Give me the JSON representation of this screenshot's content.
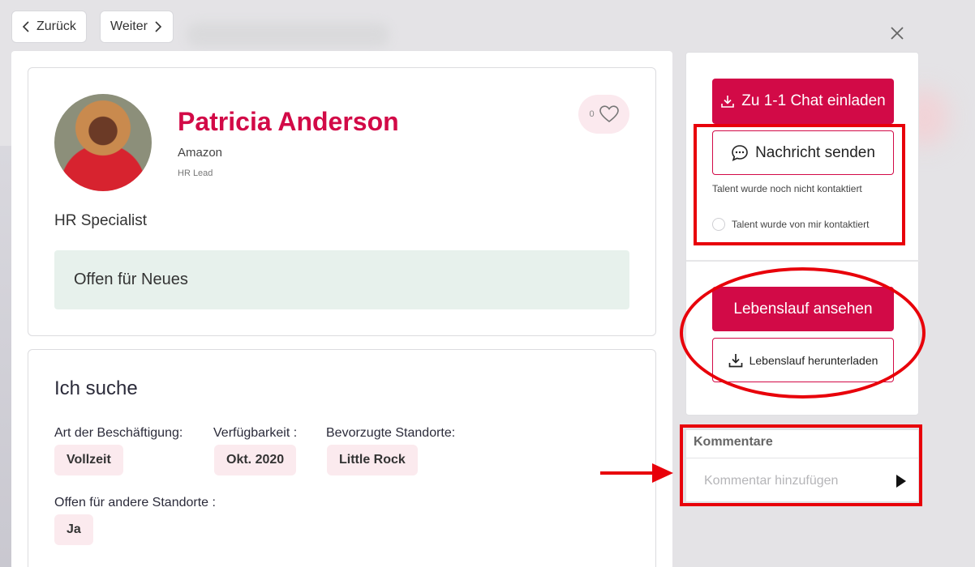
{
  "nav": {
    "back_label": "Zurück",
    "next_label": "Weiter"
  },
  "profile": {
    "name": "Patricia Anderson",
    "company": "Amazon",
    "role": "HR Lead",
    "like_count": "0",
    "job_title": "HR Specialist",
    "status_box": "Offen für Neues"
  },
  "search": {
    "title": "Ich suche",
    "employment_type_label": "Art der Beschäftigung:",
    "employment_type_value": "Vollzeit",
    "availability_label": "Verfügbarkeit :",
    "availability_value": "Okt. 2020",
    "locations_label": "Bevorzugte Standorte:",
    "locations_value": "Little Rock",
    "other_locations_label": "Offen für andere Standorte :",
    "other_locations_value": "Ja"
  },
  "actions": {
    "chat_invite_label": "Zu 1-1 Chat einladen",
    "message_label": "Nachricht senden",
    "contact_status": "Talent wurde noch nicht kontaktiert",
    "contacted_checkbox_label": "Talent wurde von mir kontaktiert",
    "cv_view_label": "Lebenslauf ansehen",
    "cv_download_label": "Lebenslauf herunterladen"
  },
  "comments": {
    "title": "Kommentare",
    "placeholder": "Kommentar hinzufügen"
  },
  "colors": {
    "brand": "#d20a47",
    "annotation": "#e8000a",
    "status_box_bg": "#e7f1ec",
    "chip_bg": "#fbeaee"
  },
  "icons": [
    "chevron-left-icon",
    "chevron-right-icon",
    "close-icon",
    "heart-icon",
    "download-icon",
    "chat-bubble-icon",
    "play-send-icon"
  ]
}
